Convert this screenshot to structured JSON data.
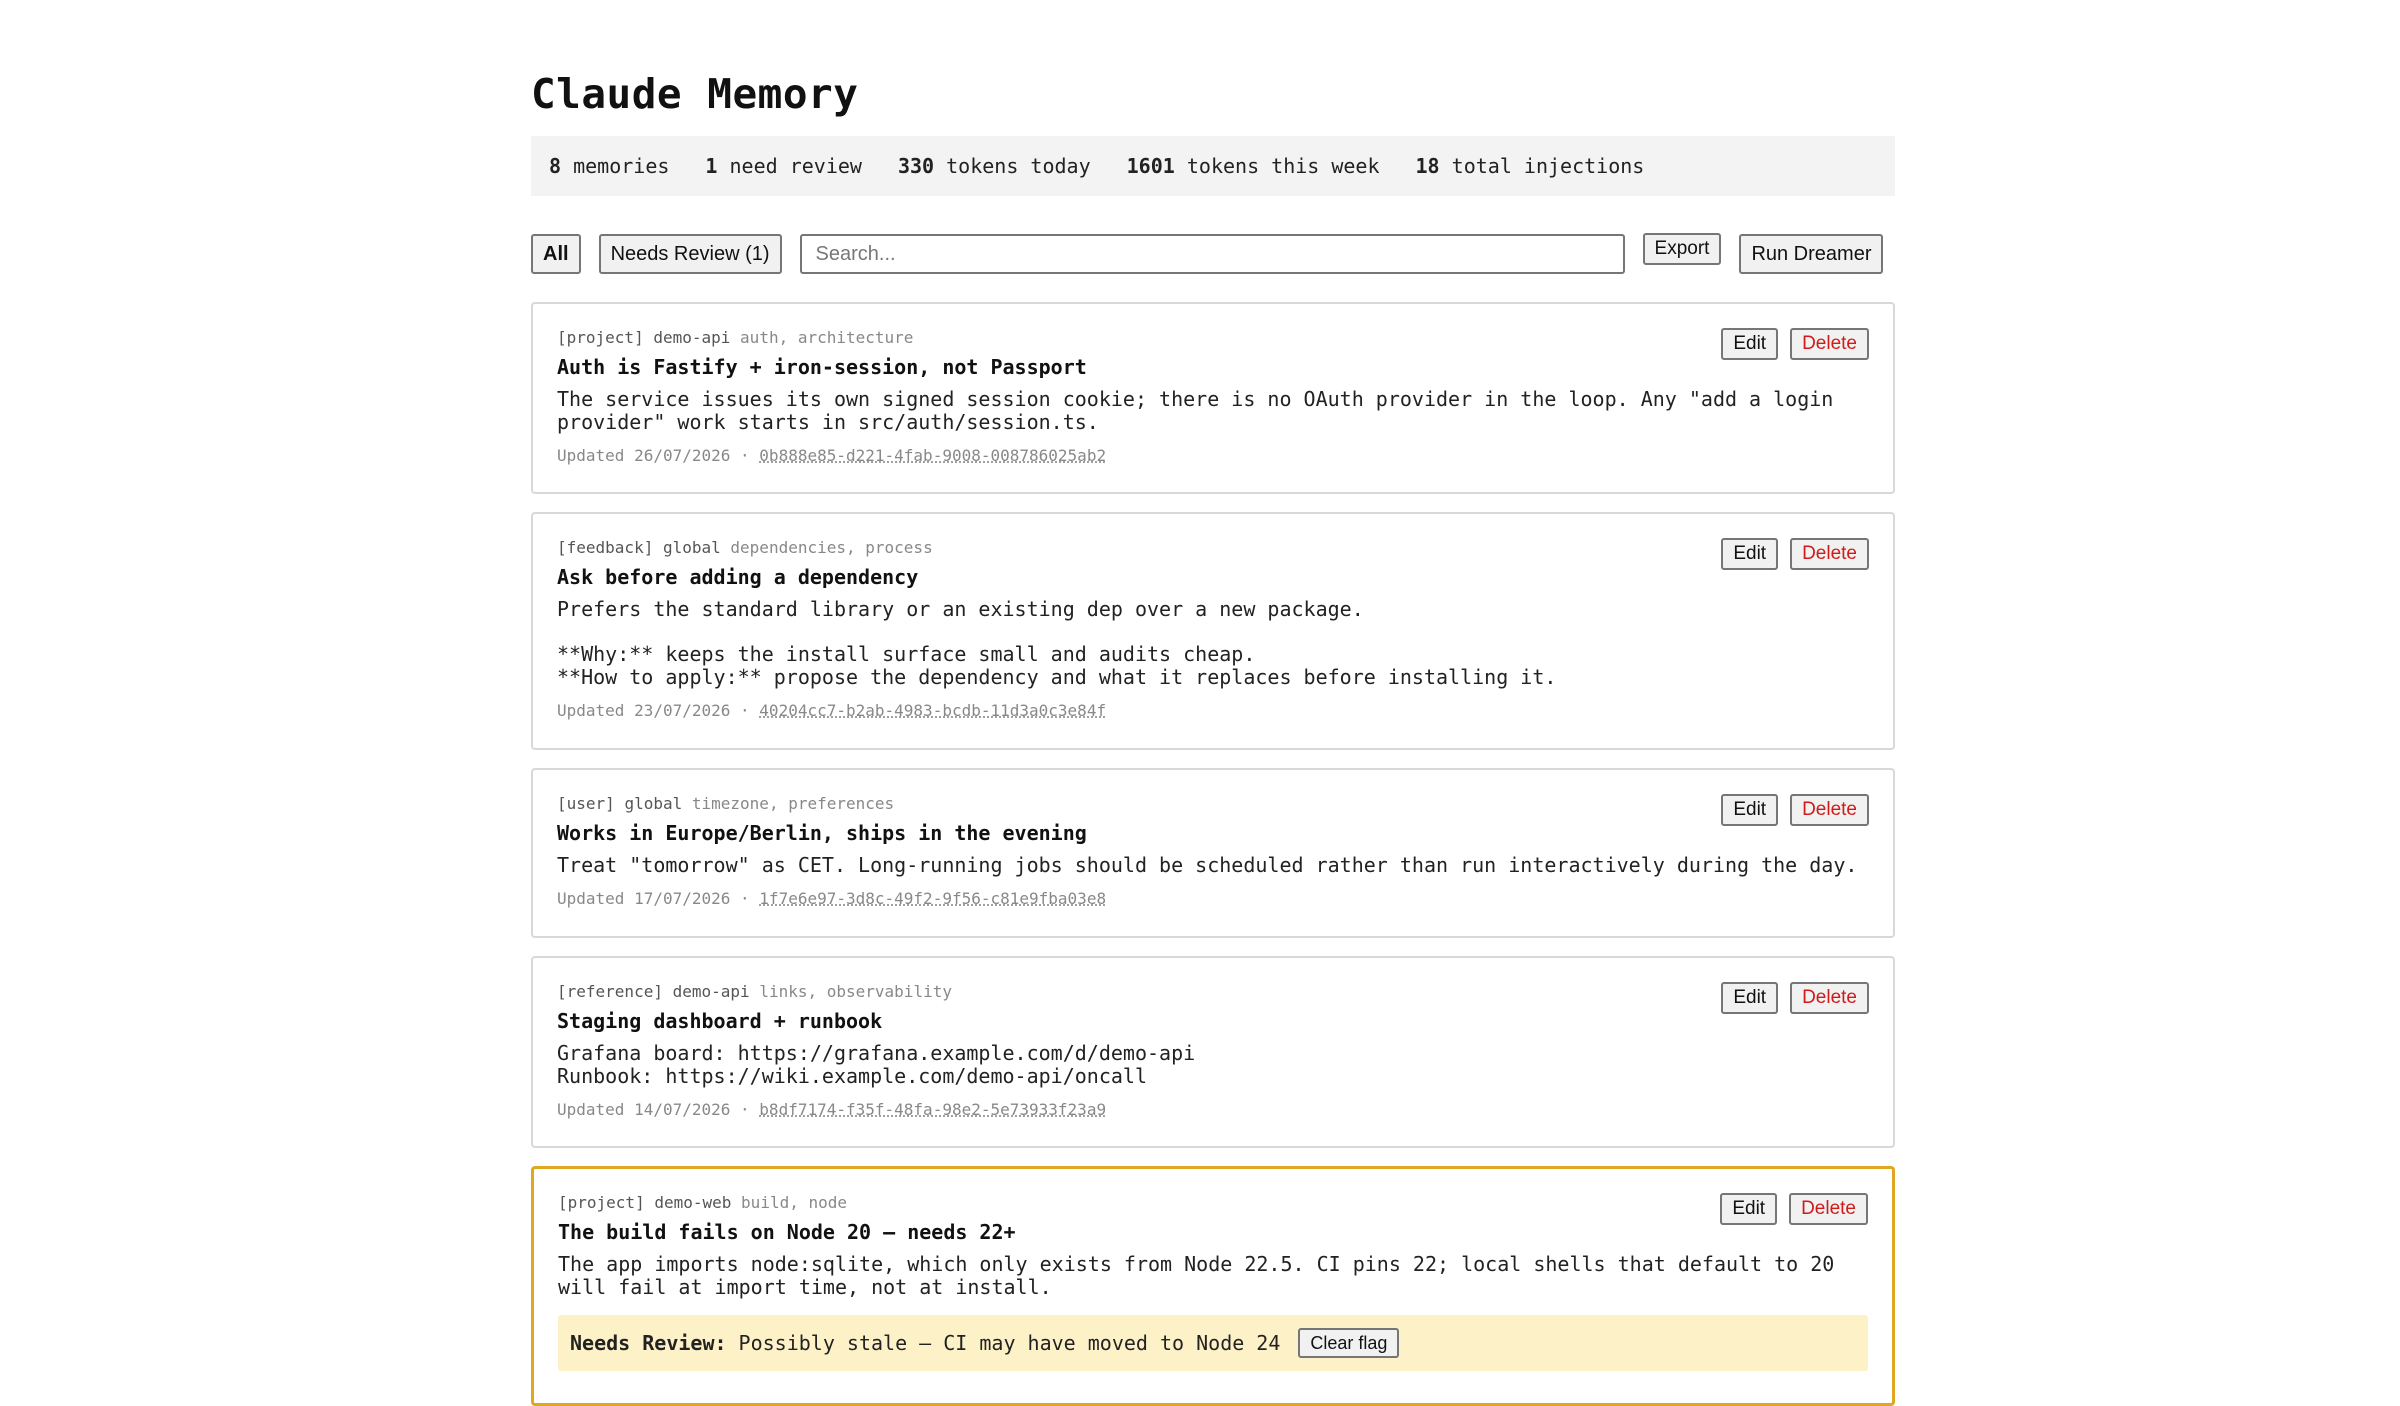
{
  "app": {
    "title": "Claude Memory"
  },
  "stats": [
    {
      "value": "8",
      "label": "memories"
    },
    {
      "value": "1",
      "label": "need review"
    },
    {
      "value": "330",
      "label": "tokens today"
    },
    {
      "value": "1601",
      "label": "tokens this week"
    },
    {
      "value": "18",
      "label": "total injections"
    }
  ],
  "toolbar": {
    "all_label": "All",
    "needs_review_label": "Needs Review (1)",
    "search_placeholder": "Search...",
    "export_label": "Export",
    "run_dreamer_label": "Run Dreamer"
  },
  "card_actions": {
    "edit_label": "Edit",
    "delete_label": "Delete",
    "clear_flag_label": "Clear flag"
  },
  "memories": [
    {
      "type": "[project]",
      "scope": "demo-api",
      "tags": "auth, architecture",
      "title": "Auth is Fastify + iron-session, not Passport",
      "body": [
        "The service issues its own signed session cookie; there is no OAuth provider in the loop. Any \"add a login\nprovider\" work starts in src/auth/session.ts."
      ],
      "updated": "Updated 26/07/2026 ·",
      "id": "0b888e85-d221-4fab-9008-008786025ab2"
    },
    {
      "type": "[feedback]",
      "scope": "global",
      "tags": "dependencies, process",
      "title": "Ask before adding a dependency",
      "body": [
        "Prefers the standard library or an existing dep over a new package.",
        "**Why:** keeps the install surface small and audits cheap.\n**How to apply:** propose the dependency and what it replaces before installing it."
      ],
      "updated": "Updated 23/07/2026 ·",
      "id": "40204cc7-b2ab-4983-bcdb-11d3a0c3e84f"
    },
    {
      "type": "[user]",
      "scope": "global",
      "tags": "timezone, preferences",
      "title": "Works in Europe/Berlin, ships in the evening",
      "body": [
        "Treat \"tomorrow\" as CET. Long-running jobs should be scheduled rather than run interactively during the day."
      ],
      "updated": "Updated 17/07/2026 ·",
      "id": "1f7e6e97-3d8c-49f2-9f56-c81e9fba03e8"
    },
    {
      "type": "[reference]",
      "scope": "demo-api",
      "tags": "links, observability",
      "title": "Staging dashboard + runbook",
      "body": [
        "Grafana board: https://grafana.example.com/d/demo-api\nRunbook: https://wiki.example.com/demo-api/oncall"
      ],
      "updated": "Updated 14/07/2026 ·",
      "id": "b8df7174-f35f-48fa-98e2-5e73933f23a9"
    },
    {
      "type": "[project]",
      "scope": "demo-web",
      "tags": "build, node",
      "title": "The build fails on Node 20 — needs 22+",
      "body": [
        "The app imports node:sqlite, which only exists from Node 22.5. CI pins 22; local shells that default to 20\nwill fail at import time, not at install."
      ],
      "review_label": "Needs Review:",
      "review_text": "Possibly stale — CI may have moved to Node 24"
    }
  ]
}
